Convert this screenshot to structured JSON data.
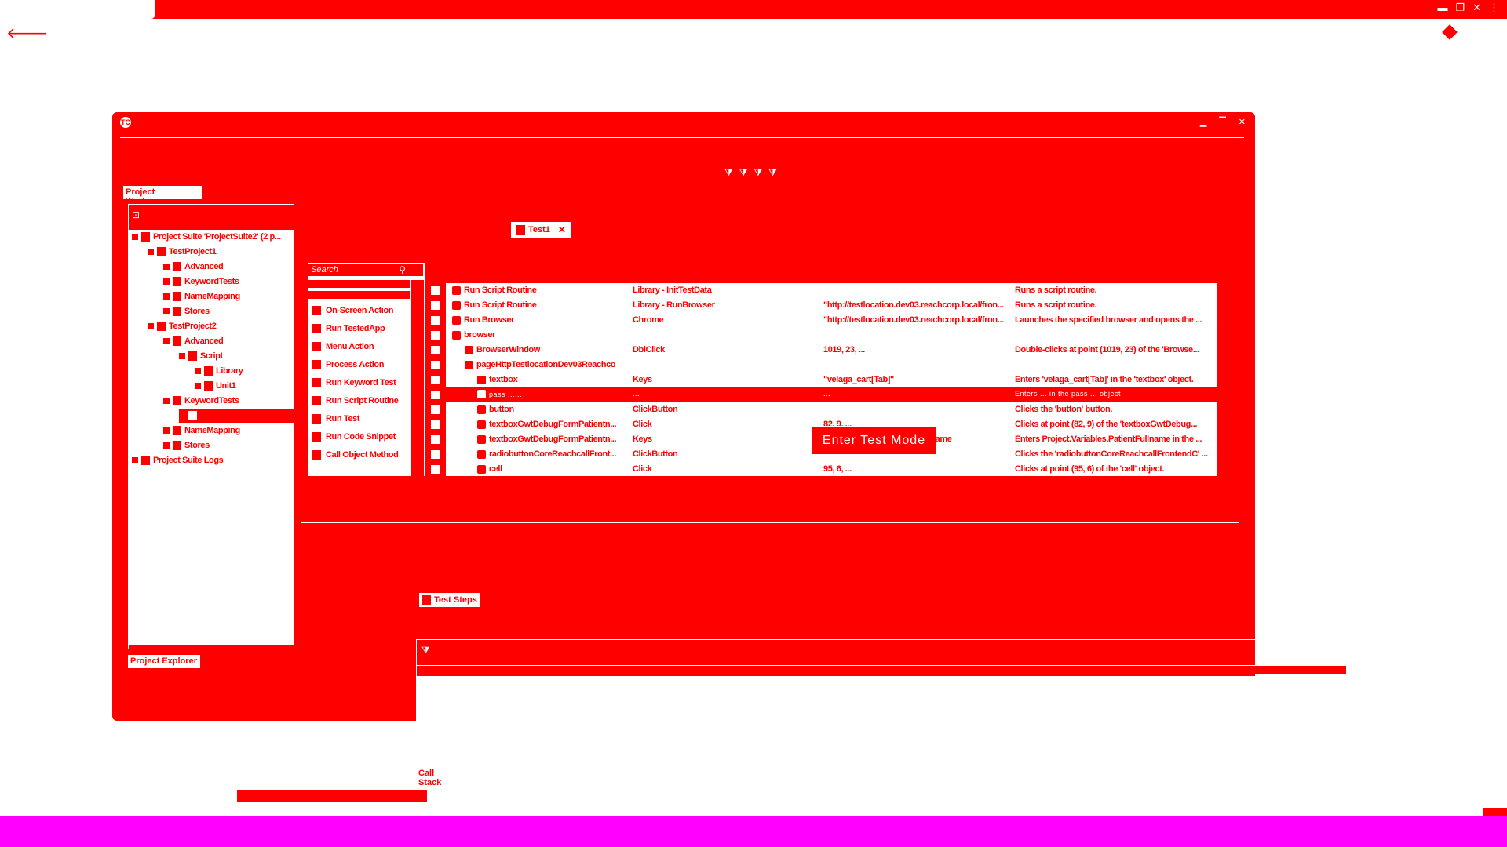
{
  "colors": {
    "accent": "#ff0000",
    "bottom_bar": "#ff00ff",
    "background": "#ffffff"
  },
  "host": {
    "window_controls": [
      "▬",
      "❐",
      "✕",
      "⋮"
    ]
  },
  "app": {
    "logo": "TC",
    "toolbar_icons": [
      "filter-icon",
      "filter-icon",
      "filter-icon",
      "filter-icon"
    ],
    "project_workspace_tab": "Project Workspace",
    "project_explorer_tab": "Project Explorer",
    "call_stack_tab": "Call Stack",
    "editor_tab": "Test1",
    "test_steps_tab": "Test Steps",
    "tooltip": "Enter Test Mode",
    "tree": [
      {
        "label": "Project Suite 'ProjectSuite2' (2 p...",
        "level": 0
      },
      {
        "label": "TestProject1",
        "level": 1
      },
      {
        "label": "Advanced",
        "level": 2
      },
      {
        "label": "KeywordTests",
        "level": 2
      },
      {
        "label": "NameMapping",
        "level": 2
      },
      {
        "label": "Stores",
        "level": 2
      },
      {
        "label": "TestProject2",
        "level": 1
      },
      {
        "label": "Advanced",
        "level": 2
      },
      {
        "label": "Script",
        "level": 3
      },
      {
        "label": "Library",
        "level": 4
      },
      {
        "label": "Unit1",
        "level": 4
      },
      {
        "label": "KeywordTests",
        "level": 2
      },
      {
        "label": "",
        "level": 3,
        "selected": true
      },
      {
        "label": "NameMapping",
        "level": 2
      },
      {
        "label": "Stores",
        "level": 2
      },
      {
        "label": "Project Suite Logs",
        "level": 0
      }
    ],
    "search_placeholder": "Search",
    "operations": [
      "On-Screen Action",
      "Run TestedApp",
      "Menu Action",
      "Process Action",
      "Run Keyword Test",
      "Run Script Routine",
      "Run Test",
      "Run Code Snippet",
      "Call Object Method"
    ],
    "rows": [
      {
        "item": "Run Script Routine",
        "operation": "Library - InitTestData",
        "value": "",
        "description": "Runs a script routine.",
        "indent": 0
      },
      {
        "item": "Run Script Routine",
        "operation": "Library - RunBrowser",
        "value": "\"http://testlocation.dev03.reachcorp.local/fron...",
        "description": "Runs a script routine.",
        "indent": 0
      },
      {
        "item": "Run Browser",
        "operation": "Chrome",
        "value": "\"http://testlocation.dev03.reachcorp.local/fron...",
        "description": "Launches the specified browser and opens the ...",
        "indent": 0
      },
      {
        "item": "browser",
        "operation": "",
        "value": "",
        "description": "",
        "indent": 0
      },
      {
        "item": "BrowserWindow",
        "operation": "DblClick",
        "value": "1019, 23, ...",
        "description": "Double-clicks at point (1019, 23) of the 'Browse...",
        "indent": 1
      },
      {
        "item": "pageHttpTestlocationDev03Reachco",
        "operation": "",
        "value": "",
        "description": "",
        "indent": 1
      },
      {
        "item": "textbox",
        "operation": "Keys",
        "value": "\"velaga_cart[Tab]\"",
        "description": "Enters 'velaga_cart[Tab]' in the 'textbox' object.",
        "indent": 2
      },
      {
        "item": "pass  ......",
        "operation": "...",
        "value": "...",
        "description": "Enters ...  in the pass  ...  object",
        "indent": 2,
        "selected": true
      },
      {
        "item": "button",
        "operation": "ClickButton",
        "value": "",
        "description": "Clicks the 'button' button.",
        "indent": 2
      },
      {
        "item": "textboxGwtDebugFormPatientn...",
        "operation": "Click",
        "value": "82, 9, ...",
        "description": "Clicks at point (82, 9) of the 'textboxGwtDebug...",
        "indent": 2
      },
      {
        "item": "textboxGwtDebugFormPatientn...",
        "operation": "Keys",
        "value": "Project.Variables.PatientFullname",
        "description": "Enters Project.Variables.PatientFullname in the ...",
        "indent": 2
      },
      {
        "item": "radiobuttonCoreReachcallFront...",
        "operation": "ClickButton",
        "value": "",
        "description": "Clicks the 'radiobuttonCoreReachcallFrontendC' ...",
        "indent": 2
      },
      {
        "item": "cell",
        "operation": "Click",
        "value": "95, 6, ...",
        "description": "Clicks at point (95, 6) of the 'cell' object.",
        "indent": 2
      }
    ]
  }
}
